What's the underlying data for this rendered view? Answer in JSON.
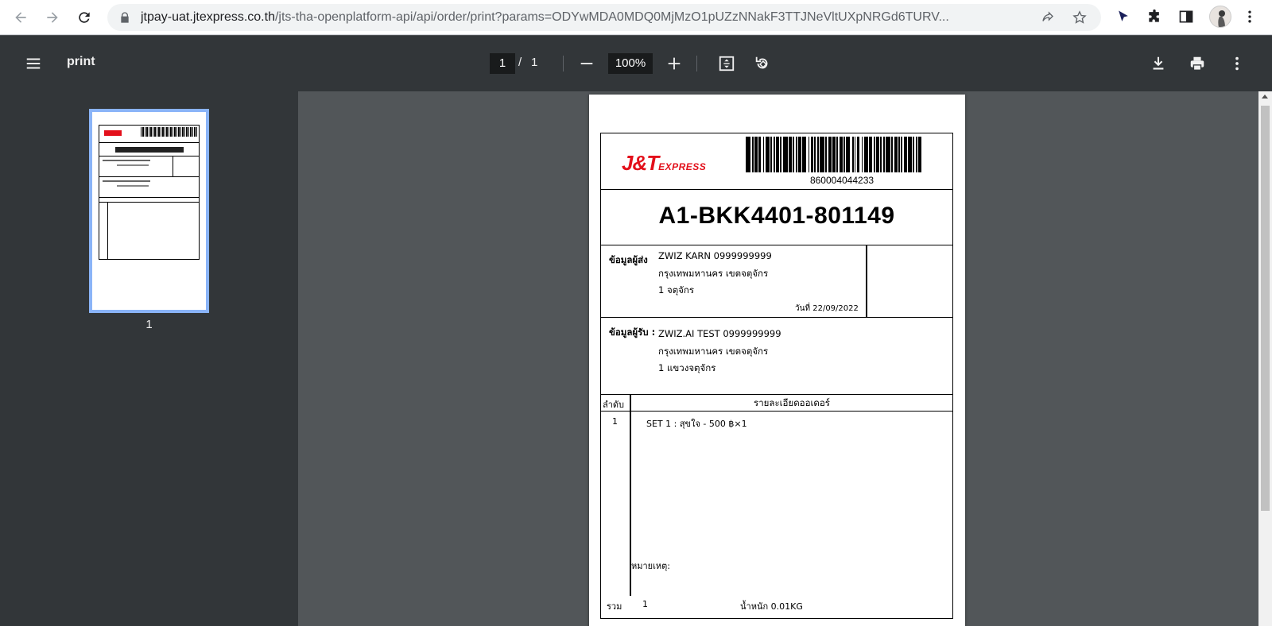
{
  "browser": {
    "url_host": "jtpay-uat.jtexpress.co.th",
    "url_path": "/jts-tha-openplatform-api/api/order/print?params=ODYwMDA0MDQ0MjMzO1pUZzNNakF3TTJNeVltUXpNRGd6TURV..."
  },
  "toolbar": {
    "title": "print",
    "current_page": "1",
    "page_separator": "/",
    "total_pages": "1",
    "zoom": "100%"
  },
  "sidebar": {
    "thumbnail_number": "1"
  },
  "waybill": {
    "brand_main": "J&T",
    "brand_sub": "EXPRESS",
    "tracking_number": "860004044233",
    "order_code": "A1-BKK4401-801149",
    "sender": {
      "label": "ข้อมูลผู้ส่ง",
      "name_phone": "ZWIZ KARN    0999999999",
      "city_district": "กรุงเทพมหานคร    เขตจตุจักร",
      "address": "1 จตุจักร",
      "date": "วันที่ 22/09/2022"
    },
    "receiver": {
      "label": "ข้อมูลผู้รับ :",
      "name_phone": "ZWIZ.AI TEST    0999999999",
      "city_district": "กรุงเทพมหานคร    เขตจตุจักร",
      "address": "1 แขวงจตุจักร"
    },
    "items": {
      "col_no": "ลำดับ",
      "col_detail": "รายละเอียดออเดอร์",
      "row_no": "1",
      "row_detail": "SET 1 :    สุขใจ - 500 ฿×1",
      "remark": "หมายเหตุ:",
      "total_label": "รวม",
      "total_qty": "1",
      "weight": "น้ำหนัก 0.01KG"
    }
  },
  "colors": {
    "toolbar_bg": "#323639",
    "viewer_bg": "#525659",
    "brand_red": "#e3101b",
    "thumb_border": "#8ab4f8"
  }
}
